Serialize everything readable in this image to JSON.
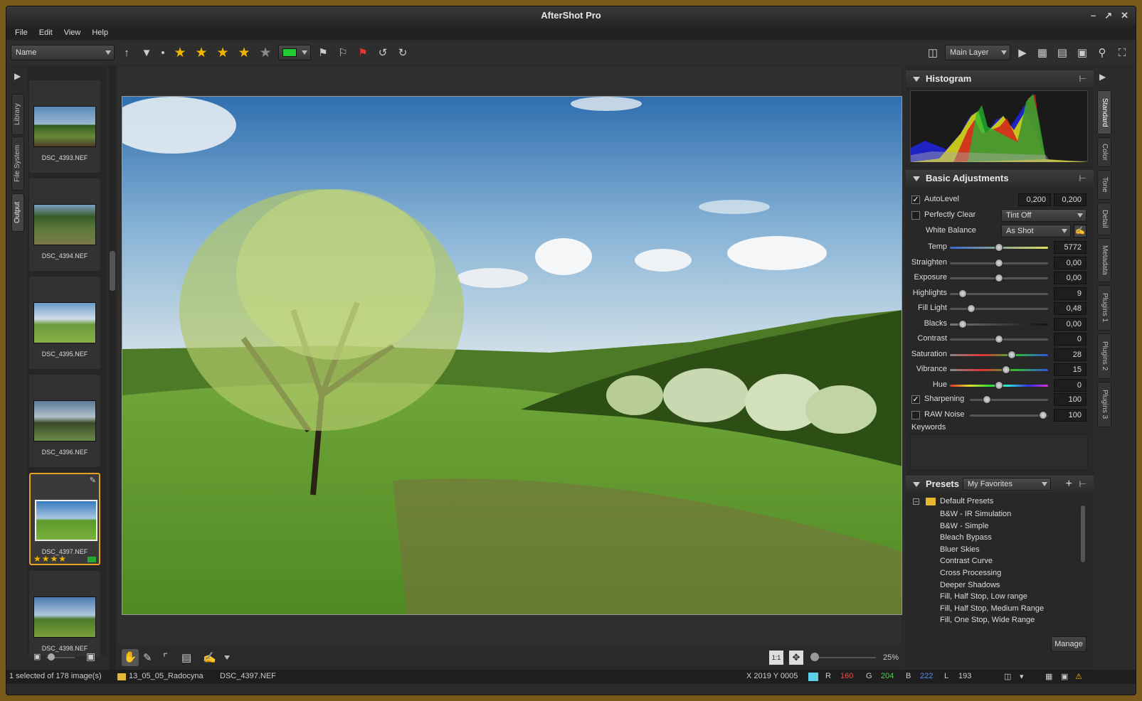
{
  "app": {
    "title": "AfterShot Pro"
  },
  "menu": [
    "File",
    "Edit",
    "View",
    "Help"
  ],
  "toolbar": {
    "sort_value": "Name",
    "layer_value": "Main Layer",
    "color_label": "#22cc33",
    "stars_filter": 5
  },
  "left_tabs": [
    "Library",
    "File System",
    "Output"
  ],
  "filmstrip": [
    {
      "name": "DSC_4393.NEF",
      "selected": false
    },
    {
      "name": "DSC_4394.NEF",
      "selected": false
    },
    {
      "name": "DSC_4395.NEF",
      "selected": false
    },
    {
      "name": "DSC_4396.NEF",
      "selected": false
    },
    {
      "name": "DSC_4397.NEF",
      "selected": true,
      "rating": 4,
      "color_label": "#22aa33"
    },
    {
      "name": "DSC_4398.NEF",
      "selected": false
    }
  ],
  "histogram": {
    "title": "Histogram"
  },
  "basic": {
    "title": "Basic Adjustments",
    "autolevel": {
      "label": "AutoLevel",
      "checked": true,
      "v1": "0,200",
      "v2": "0,200"
    },
    "perfectly_clear": {
      "label": "Perfectly Clear",
      "checked": false,
      "value": "Tint Off"
    },
    "white_balance": {
      "label": "White Balance",
      "value": "As Shot"
    },
    "sliders": [
      {
        "label": "Temp",
        "value": "5772",
        "pos": 0.5
      },
      {
        "label": "Straighten",
        "value": "0,00",
        "pos": 0.5
      },
      {
        "label": "Exposure",
        "value": "0,00",
        "pos": 0.5
      },
      {
        "label": "Highlights",
        "value": "9",
        "pos": 0.13
      },
      {
        "label": "Fill Light",
        "value": "0,48",
        "pos": 0.22
      },
      {
        "label": "Blacks",
        "value": "0,00",
        "pos": 0.13
      },
      {
        "label": "Contrast",
        "value": "0",
        "pos": 0.5
      },
      {
        "label": "Saturation",
        "value": "28",
        "pos": 0.63
      },
      {
        "label": "Vibrance",
        "value": "15",
        "pos": 0.57
      },
      {
        "label": "Hue",
        "value": "0",
        "pos": 0.5
      }
    ],
    "sharpening": {
      "label": "Sharpening",
      "checked": true,
      "value": "100",
      "pos": 0.22
    },
    "raw_noise": {
      "label": "RAW Noise",
      "checked": false,
      "value": "100",
      "pos": 0.94
    },
    "keywords_label": "Keywords"
  },
  "presets": {
    "title": "Presets",
    "filter": "My Favorites",
    "folder": "Default Presets",
    "items": [
      "B&W - IR Simulation",
      "B&W - Simple",
      "Bleach Bypass",
      "Bluer Skies",
      "Contrast Curve",
      "Cross Processing",
      "Deeper Shadows",
      "Fill, Half Stop, Low range",
      "Fill, Half Stop, Medium Range",
      "Fill, One Stop, Wide Range"
    ],
    "manage_label": "Manage"
  },
  "right_tabs": [
    "Standard",
    "Color",
    "Tone",
    "Detail",
    "Metadata",
    "Plugins 1",
    "Plugins 2",
    "Plugins 3"
  ],
  "viewer_tools": {
    "zoom": "25%",
    "one_to_one": "1:1"
  },
  "status": {
    "selection": "1 selected of 178 image(s)",
    "folder": "13_05_05_Radocyna",
    "file": "DSC_4397.NEF",
    "coords": "X 2019  Y 0005",
    "r_label": "R",
    "r": "160",
    "g_label": "G",
    "g": "204",
    "b_label": "B",
    "b": "222",
    "l_label": "L",
    "l": "193"
  }
}
